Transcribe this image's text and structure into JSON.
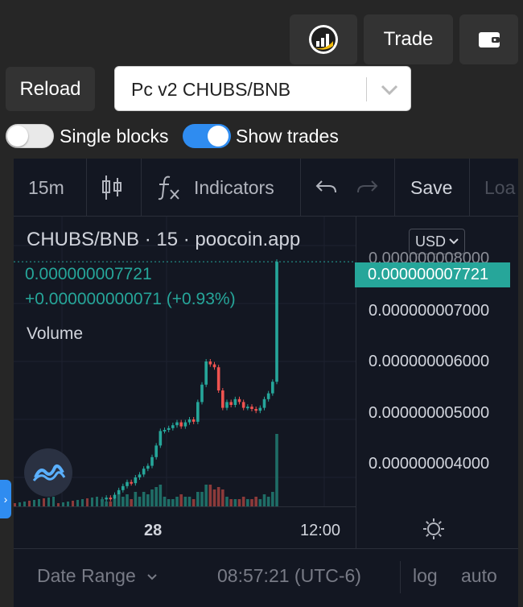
{
  "header": {
    "trade_label": "Trade",
    "reload_label": "Reload",
    "pair_value": "Pc v2 CHUBS/BNB"
  },
  "toggles": {
    "single_blocks": {
      "label": "Single blocks",
      "on": false
    },
    "show_trades": {
      "label": "Show trades",
      "on": true
    }
  },
  "chart_toolbar": {
    "interval": "15m",
    "indicators": "Indicators",
    "save": "Save",
    "load": "Loa"
  },
  "chart_legend": {
    "title": "CHUBS/BNB · 15 · poocoin.app",
    "price": "0.000000007721",
    "change": "+0.000000000071 (+0.93%)",
    "volume": "Volume"
  },
  "price_axis": {
    "currency": "USD",
    "current_price": "0.000000007721",
    "ticks": [
      "0.000000008000",
      "0.000000007000",
      "0.000000006000",
      "0.000000005000",
      "0.000000004000"
    ]
  },
  "time_axis": {
    "ticks": [
      "28",
      "12:00"
    ]
  },
  "bottom_bar": {
    "date_range": "Date Range",
    "clock": "08:57:21 (UTC-6)",
    "log": "log",
    "auto": "auto"
  },
  "colors": {
    "up": "#26a69a",
    "down": "#ef5350",
    "toggle_on": "#2f8cf0",
    "background": "#131722"
  },
  "chart_data": {
    "type": "candlestick",
    "title": "CHUBS/BNB · 15 · poocoin.app",
    "ylim": [
      3.5e-09,
      8.5e-09
    ],
    "y_ticks": [
      8e-09,
      7e-09,
      6e-09,
      5e-09,
      4e-09
    ],
    "x_ticks": [
      "28",
      "12:00"
    ],
    "current_price": 7.721e-09,
    "candles": [
      {
        "o": 3.58,
        "c": 3.62,
        "v": 0.3
      },
      {
        "o": 3.62,
        "c": 3.65,
        "v": 0.2
      },
      {
        "o": 3.65,
        "c": 3.63,
        "v": 0.2
      },
      {
        "o": 3.63,
        "c": 3.7,
        "v": 0.3
      },
      {
        "o": 3.7,
        "c": 3.78,
        "v": 0.5
      },
      {
        "o": 3.78,
        "c": 3.85,
        "v": 0.4
      },
      {
        "o": 3.85,
        "c": 3.92,
        "v": 0.5
      },
      {
        "o": 3.92,
        "c": 3.9,
        "v": 0.3
      },
      {
        "o": 3.9,
        "c": 4.0,
        "v": 0.6
      },
      {
        "o": 4.0,
        "c": 4.05,
        "v": 0.4
      },
      {
        "o": 4.05,
        "c": 4.15,
        "v": 0.6
      },
      {
        "o": 4.15,
        "c": 4.2,
        "v": 0.5
      },
      {
        "o": 4.2,
        "c": 4.35,
        "v": 0.7
      },
      {
        "o": 4.35,
        "c": 4.55,
        "v": 0.8
      },
      {
        "o": 4.55,
        "c": 4.8,
        "v": 0.9
      },
      {
        "o": 4.8,
        "c": 4.82,
        "v": 0.4
      },
      {
        "o": 4.82,
        "c": 4.85,
        "v": 0.3
      },
      {
        "o": 4.85,
        "c": 4.9,
        "v": 0.3
      },
      {
        "o": 4.9,
        "c": 4.95,
        "v": 0.4
      },
      {
        "o": 4.95,
        "c": 4.88,
        "v": 0.5
      },
      {
        "o": 4.88,
        "c": 4.95,
        "v": 0.4
      },
      {
        "o": 4.95,
        "c": 5.0,
        "v": 0.4
      },
      {
        "o": 5.0,
        "c": 4.96,
        "v": 0.3
      },
      {
        "o": 4.96,
        "c": 5.3,
        "v": 0.6
      },
      {
        "o": 5.3,
        "c": 5.6,
        "v": 0.6
      },
      {
        "o": 5.6,
        "c": 6.0,
        "v": 0.9
      },
      {
        "o": 6.0,
        "c": 5.95,
        "v": 0.9
      },
      {
        "o": 5.95,
        "c": 5.9,
        "v": 0.7
      },
      {
        "o": 5.9,
        "c": 5.5,
        "v": 0.8
      },
      {
        "o": 5.5,
        "c": 5.2,
        "v": 0.7
      },
      {
        "o": 5.2,
        "c": 5.3,
        "v": 0.4
      },
      {
        "o": 5.3,
        "c": 5.25,
        "v": 0.3
      },
      {
        "o": 5.25,
        "c": 5.35,
        "v": 0.3
      },
      {
        "o": 5.35,
        "c": 5.3,
        "v": 0.3
      },
      {
        "o": 5.3,
        "c": 5.2,
        "v": 0.4
      },
      {
        "o": 5.2,
        "c": 5.22,
        "v": 0.3
      },
      {
        "o": 5.22,
        "c": 5.18,
        "v": 0.3
      },
      {
        "o": 5.18,
        "c": 5.15,
        "v": 0.4
      },
      {
        "o": 5.15,
        "c": 5.2,
        "v": 0.3
      },
      {
        "o": 5.2,
        "c": 5.35,
        "v": 0.5
      },
      {
        "o": 5.35,
        "c": 5.45,
        "v": 0.4
      },
      {
        "o": 5.45,
        "c": 5.65,
        "v": 0.6
      },
      {
        "o": 5.65,
        "c": 7.72,
        "v": 3.0
      }
    ]
  }
}
